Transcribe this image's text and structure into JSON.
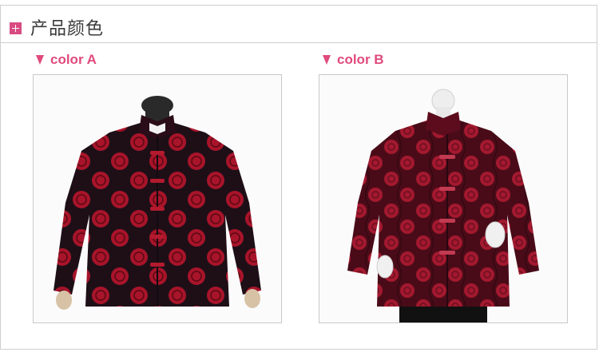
{
  "header": {
    "title": "产品颜色",
    "icon": "plus-icon",
    "accent": "#d94c83"
  },
  "products": [
    {
      "label": "color A",
      "colors": {
        "base": "#211018",
        "pattern": "#b5152a"
      }
    },
    {
      "label": "color B",
      "colors": {
        "base": "#5a0d1c",
        "pattern": "#b01e34"
      }
    }
  ],
  "colors": {
    "label": "#e04a7e",
    "border": "#cfcfcf"
  }
}
